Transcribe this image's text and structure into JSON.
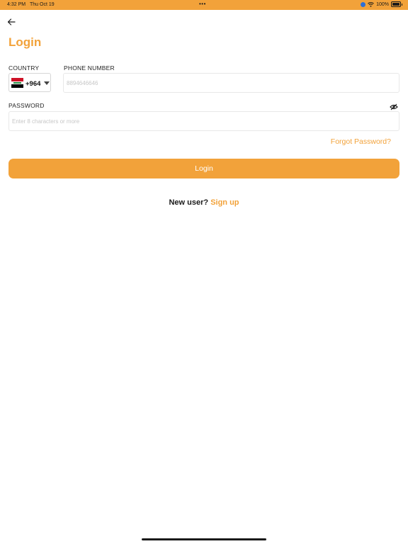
{
  "status_bar": {
    "time": "4:32 PM",
    "date": "Thu Oct 19",
    "multitask_dots": "•••",
    "battery_percent": "100%",
    "icons": [
      "location-icon",
      "wifi-icon",
      "battery-icon"
    ]
  },
  "header": {
    "back_icon": "arrow-left-icon",
    "title": "Login"
  },
  "form": {
    "country_label": "COUNTRY",
    "country_code": "+964",
    "country_flag": "iraq-flag-icon",
    "phone_label": "PHONE NUMBER",
    "phone_placeholder": "8894646646",
    "password_label": "PASSWORD",
    "password_placeholder": "Enter 8 characters or more",
    "password_visibility_icon": "eye-off-icon",
    "forgot_password": "Forgot Password?"
  },
  "actions": {
    "login_label": "Login",
    "new_user_text": "New user?",
    "signup_link": "Sign up"
  },
  "colors": {
    "accent": "#f2a23a",
    "text": "#1a1a1a",
    "placeholder": "#c7c7c7",
    "border": "#e8e8e8"
  }
}
